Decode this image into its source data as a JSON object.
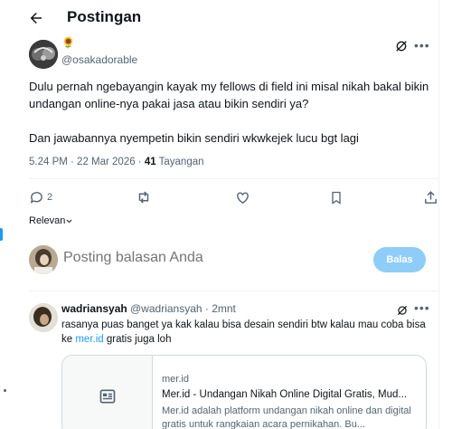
{
  "header": {
    "title": "Postingan"
  },
  "post": {
    "flower_emoji": "🌻",
    "handle": "@osakadorable",
    "paragraphs": [
      "Dulu pernah ngebayangin kayak my fellows di field ini misal nikah bakal bikin undangan online-nya pakai jasa atau bikin sendiri ya?",
      "Dan jawabannya nyempetin bikin sendiri wkwkejek lucu bgt lagi"
    ],
    "time": "5.24 PM · 22 Mar 2026 · ",
    "views_count": "41",
    "views_label": " Tayangan",
    "reply_count": "2"
  },
  "sort": {
    "label": "Relevan"
  },
  "reply_box": {
    "placeholder": "Posting balasan Anda",
    "button_label": "Balas"
  },
  "comment": {
    "name": "wadriansyah",
    "handle_time": "@wadriansyah · 2mnt",
    "text_before_link": "rasanya puas banget ya kak kalau bisa desain sendiri btw kalau mau coba bisa ke ",
    "link_text": "mer.id",
    "text_after_link": " gratis juga loh",
    "card": {
      "domain": "mer.id",
      "title": "Mer.id - Undangan Nikah Online Digital Gratis, Mud...",
      "description": "Mer.id adalah platform undangan nikah online dan digital gratis untuk rangkaian acara pernikahan. Bu..."
    }
  },
  "colors": {
    "accent": "#1d9bf0",
    "muted": "#536471",
    "reply_button_disabled": "#8ecdf8"
  },
  "icons": {
    "back": "arrow-left-icon",
    "grok": "grok-icon",
    "more": "more-icon",
    "reply": "reply-icon",
    "repost": "repost-icon",
    "like": "like-icon",
    "bookmark": "bookmark-icon",
    "share": "share-icon",
    "link_card": "article-icon"
  }
}
